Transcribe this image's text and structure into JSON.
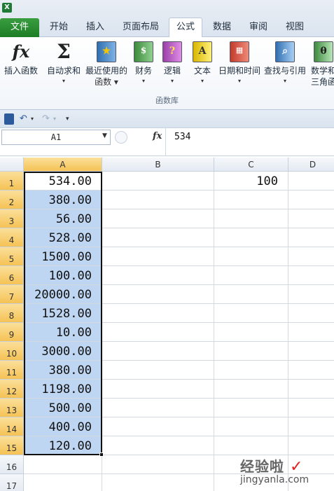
{
  "app_icon": "excel-icon",
  "tabs": [
    {
      "label": "文件"
    },
    {
      "label": "开始"
    },
    {
      "label": "插入"
    },
    {
      "label": "页面布局"
    },
    {
      "label": "公式"
    },
    {
      "label": "数据"
    },
    {
      "label": "审阅"
    },
    {
      "label": "视图"
    }
  ],
  "active_tab": "公式",
  "ribbon": {
    "buttons": [
      {
        "label": "插入函数",
        "label2": "",
        "icon": "fx-icon"
      },
      {
        "label": "自动求和",
        "label2": "▾",
        "icon": "sigma-icon"
      },
      {
        "label": "最近使用的",
        "label2": "函数 ▾",
        "icon": "star-book-icon"
      },
      {
        "label": "财务",
        "label2": "▾",
        "icon": "finance-book-icon"
      },
      {
        "label": "逻辑",
        "label2": "▾",
        "icon": "question-book-icon"
      },
      {
        "label": "文本",
        "label2": "▾",
        "icon": "text-book-icon"
      },
      {
        "label": "日期和时间",
        "label2": "▾",
        "icon": "calendar-book-icon"
      },
      {
        "label": "查找与引用",
        "label2": "▾",
        "icon": "search-book-icon"
      },
      {
        "label": "数学和",
        "label2": "三角函",
        "icon": "theta-book-icon"
      }
    ],
    "group_label": "函数库"
  },
  "formula_bar": {
    "name_box": "A1",
    "fx_label": "fx",
    "value": "534"
  },
  "sheet": {
    "columns": [
      "A",
      "B",
      "C",
      "D"
    ],
    "rows": [
      "1",
      "2",
      "3",
      "4",
      "5",
      "6",
      "7",
      "8",
      "9",
      "10",
      "11",
      "12",
      "13",
      "14",
      "15",
      "16",
      "17"
    ],
    "column_a": [
      "534.00",
      "380.00",
      "56.00",
      "528.00",
      "1500.00",
      "100.00",
      "20000.00",
      "1528.00",
      "10.00",
      "3000.00",
      "380.00",
      "1198.00",
      "500.00",
      "400.00",
      "120.00",
      "",
      ""
    ],
    "c1": "100"
  },
  "watermark": {
    "line1": "经验啦",
    "check": "✓",
    "line2": "jingyanla.com"
  }
}
